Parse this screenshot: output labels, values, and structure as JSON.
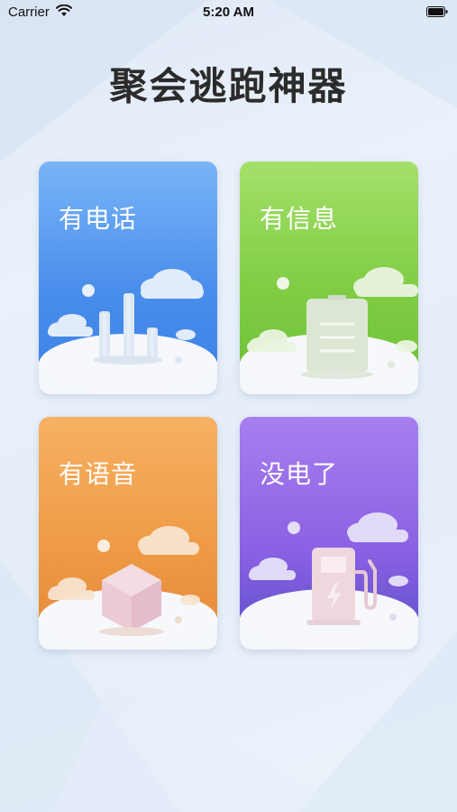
{
  "status_bar": {
    "carrier": "Carrier",
    "time": "5:20 AM",
    "wifi_icon": "wifi-icon",
    "battery_icon": "battery-icon"
  },
  "title": "聚会逃跑神器",
  "cards": [
    {
      "label": "有电话",
      "icon": "bar-chart-icon",
      "color": "#4a8eec"
    },
    {
      "label": "有信息",
      "icon": "message-clipboard-icon",
      "color": "#80cd44"
    },
    {
      "label": "有语音",
      "icon": "cube-icon",
      "color": "#ef9b45"
    },
    {
      "label": "没电了",
      "icon": "charging-station-icon",
      "color": "#8d62e4"
    }
  ]
}
